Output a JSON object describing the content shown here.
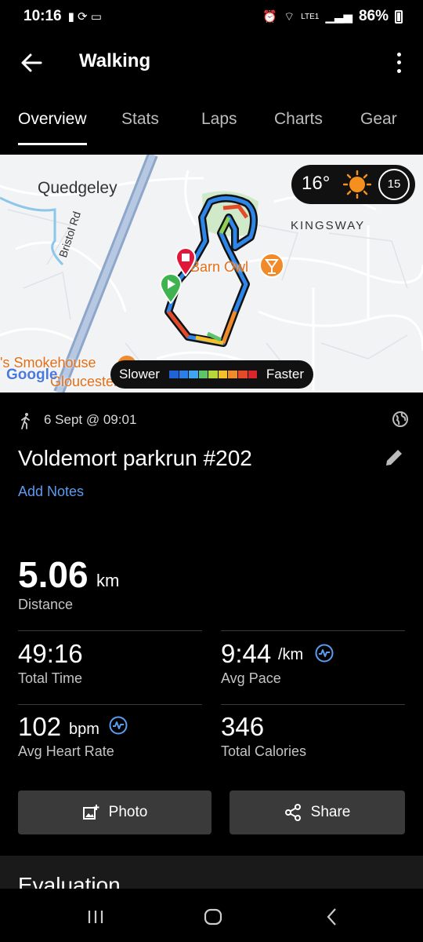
{
  "status_bar": {
    "time": "10:16",
    "battery": "86%",
    "network": "LTE1"
  },
  "app_bar": {
    "title": "Walking",
    "back_icon": "arrow-left-icon",
    "menu_icon": "more-vert-icon"
  },
  "tabs": [
    {
      "label": "Overview",
      "active": true
    },
    {
      "label": "Stats",
      "active": false
    },
    {
      "label": "Laps",
      "active": false
    },
    {
      "label": "Charts",
      "active": false
    },
    {
      "label": "Gear",
      "active": false
    }
  ],
  "map": {
    "labels": {
      "quedgeley": "Quedgeley",
      "kingsway": "KINGSWAY",
      "bristol_rd": "Bristol Rd",
      "barn_owl": "Barn Owl",
      "smokehouse": "'s Smokehouse",
      "gloucester": "Gloucester",
      "google": "Google"
    },
    "weather": {
      "temperature": "16°",
      "wind": "15",
      "condition_icon": "sun-icon"
    },
    "legend": {
      "slower": "Slower",
      "faster": "Faster",
      "colors": [
        "#1f63d6",
        "#2c7fe8",
        "#3ea6f0",
        "#5ec46a",
        "#b7d63a",
        "#f4c02a",
        "#f18a28",
        "#e24a2a",
        "#d8262b"
      ]
    }
  },
  "activity": {
    "date": "6 Sept @ 09:01",
    "name": "Voldemort parkrun #202",
    "add_notes": "Add Notes"
  },
  "stats": {
    "distance": {
      "value": "5.06",
      "unit": "km",
      "label": "Distance"
    },
    "total_time": {
      "value": "49:16",
      "label": "Total Time"
    },
    "avg_pace": {
      "value": "9:44",
      "unit": "/km",
      "label": "Avg Pace"
    },
    "avg_hr": {
      "value": "102",
      "unit": "bpm",
      "label": "Avg Heart Rate"
    },
    "calories": {
      "value": "346",
      "label": "Total Calories"
    }
  },
  "actions": {
    "photo": "Photo",
    "share": "Share"
  },
  "evaluation": {
    "title": "Evaluation"
  },
  "colors": {
    "accent_blue": "#5b9cf0",
    "button_bg": "#3a3a3a",
    "start_marker": "#3fb34f",
    "end_marker": "#e0193a"
  }
}
